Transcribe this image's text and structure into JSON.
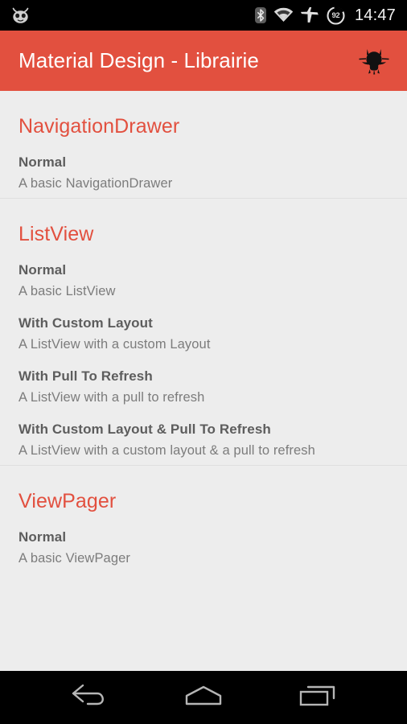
{
  "status_bar": {
    "left_icon": "cyanogenmod-cid-icon",
    "icons": [
      "bluetooth-icon",
      "wifi-icon",
      "airplane-mode-icon"
    ],
    "battery_level": "92",
    "time": "14:47"
  },
  "app_bar": {
    "title": "Material Design - Librairie",
    "action_icon": "github-octocat-icon",
    "background_color": "#e2503f",
    "title_color": "#ffffff"
  },
  "theme": {
    "accent_color": "#e2503f",
    "content_background": "#ededed",
    "item_title_color": "#5d5d5d",
    "item_subtitle_color": "#7c7c7c",
    "divider_color": "#dfdfdf"
  },
  "sections": [
    {
      "header": "NavigationDrawer",
      "items": [
        {
          "title": "Normal",
          "subtitle": "A basic NavigationDrawer"
        }
      ]
    },
    {
      "header": "ListView",
      "items": [
        {
          "title": "Normal",
          "subtitle": "A basic ListView"
        },
        {
          "title": "With Custom Layout",
          "subtitle": "A ListView with a custom Layout"
        },
        {
          "title": "With Pull To Refresh",
          "subtitle": "A ListView with a pull to refresh"
        },
        {
          "title": "With Custom Layout & Pull To Refresh",
          "subtitle": "A ListView with a custom layout & a pull to refresh"
        }
      ]
    },
    {
      "header": "ViewPager",
      "items": [
        {
          "title": "Normal",
          "subtitle": "A basic ViewPager"
        }
      ]
    }
  ],
  "nav_bar": {
    "buttons": [
      {
        "name": "back-button",
        "icon": "back-arrow-icon"
      },
      {
        "name": "home-button",
        "icon": "home-icon"
      },
      {
        "name": "recents-button",
        "icon": "recents-icon"
      }
    ]
  }
}
